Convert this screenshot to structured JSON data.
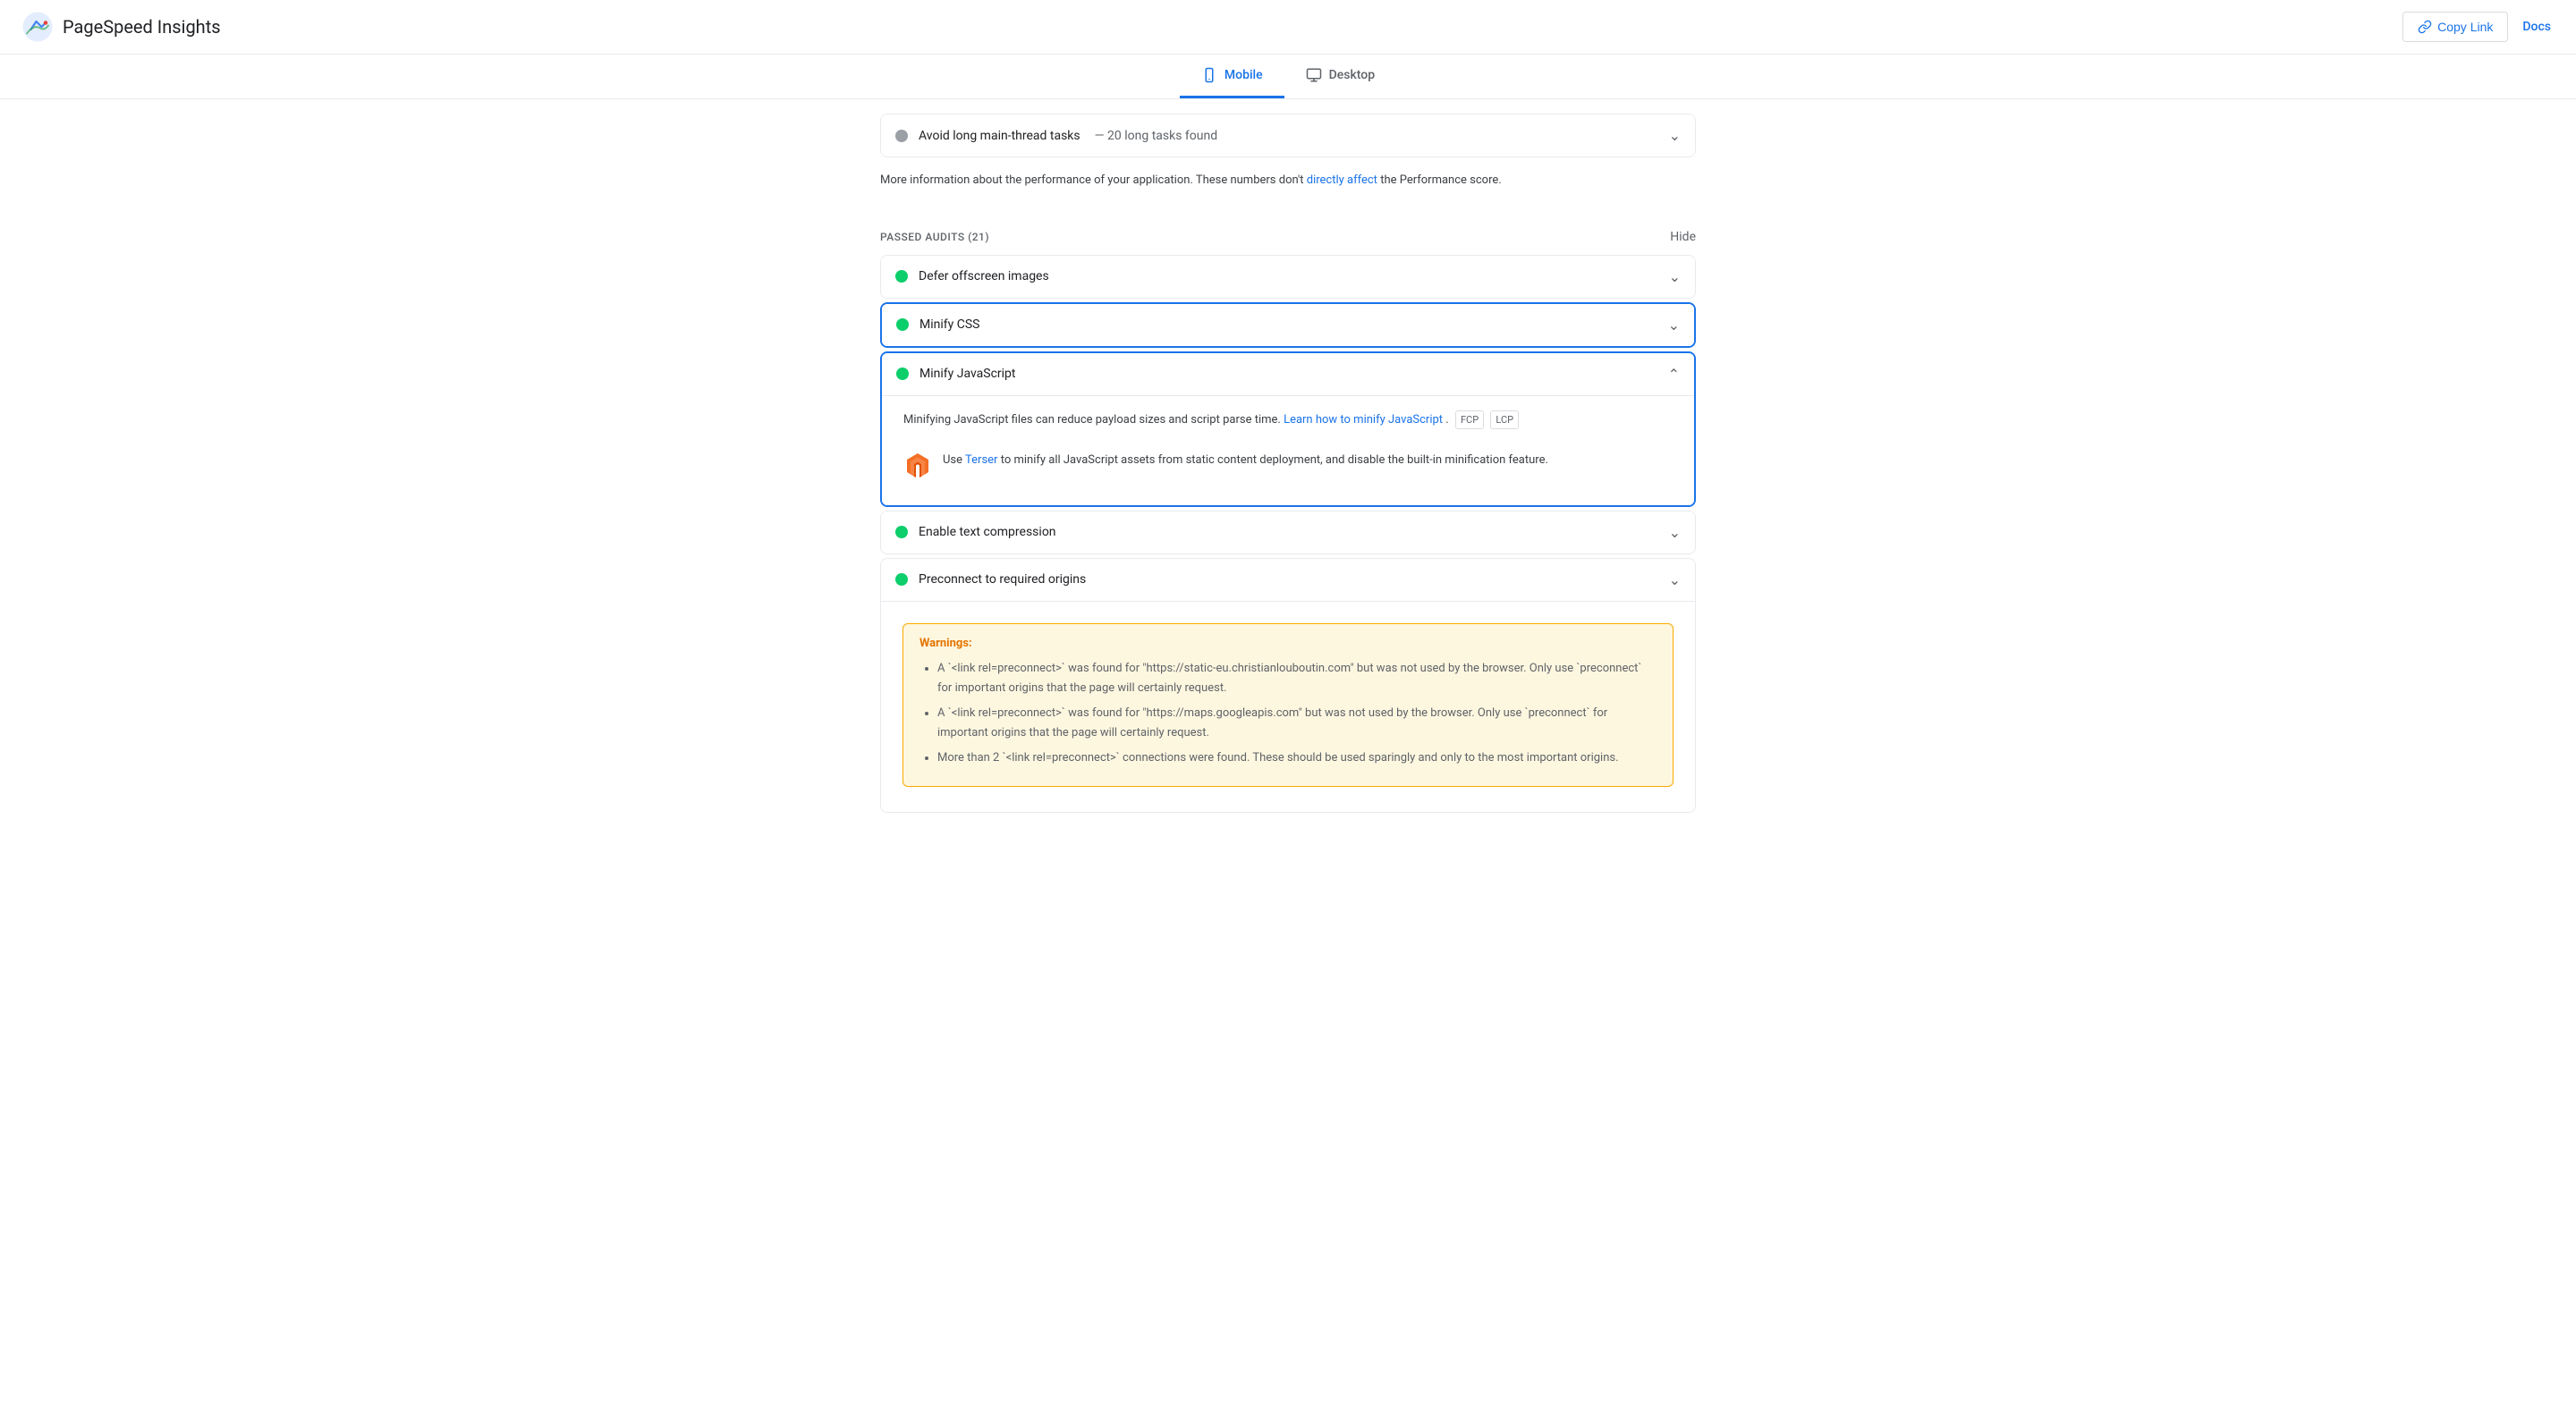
{
  "header": {
    "logo_text": "PageSpeed Insights",
    "copy_link_label": "Copy Link",
    "docs_label": "Docs"
  },
  "tabs": [
    {
      "id": "mobile",
      "label": "Mobile",
      "active": true
    },
    {
      "id": "desktop",
      "label": "Desktop",
      "active": false
    }
  ],
  "main_thread_audit": {
    "title": "Avoid long main-thread tasks",
    "subtitle": "— 20 long tasks found",
    "status": "grey",
    "expanded": false
  },
  "info_text": "More information about the performance of your application. These numbers don't",
  "info_link_text": "directly affect",
  "info_text_after": "the Performance score.",
  "passed_audits": {
    "section_title": "PASSED AUDITS (21)",
    "hide_label": "Hide"
  },
  "audits": [
    {
      "id": "defer-offscreen",
      "title": "Defer offscreen images",
      "status": "green",
      "expanded": false,
      "chevron": "down"
    },
    {
      "id": "minify-css",
      "title": "Minify CSS",
      "status": "green",
      "expanded": false,
      "chevron": "down"
    },
    {
      "id": "minify-js",
      "title": "Minify JavaScript",
      "status": "green",
      "expanded": true,
      "chevron": "up",
      "description_before": "Minifying JavaScript files can reduce payload sizes and script parse time.",
      "description_link_text": "Learn how to minify JavaScript",
      "description_after": ".",
      "tags": [
        "FCP",
        "LCP"
      ],
      "suggestion_link_text": "Terser",
      "suggestion_text_before": "Use",
      "suggestion_text_after": "to minify all JavaScript assets from static content deployment, and disable the built-in minification feature."
    },
    {
      "id": "text-compression",
      "title": "Enable text compression",
      "status": "green",
      "expanded": false,
      "chevron": "down"
    },
    {
      "id": "preconnect",
      "title": "Preconnect to required origins",
      "status": "green",
      "expanded": true,
      "chevron": "down",
      "warnings_title": "Warnings:",
      "warnings": [
        "A `<link rel=preconnect>` was found for \"https://static-eu.christianlouboutin.com\" but was not used by the browser. Only use `preconnect` for important origins that the page will certainly request.",
        "A `<link rel=preconnect>` was found for \"https://maps.googleapis.com\" but was not used by the browser. Only use `preconnect` for important origins that the page will certainly request.",
        "More than 2 `<link rel=preconnect>` connections were found. These should be used sparingly and only to the most important origins."
      ]
    }
  ],
  "colors": {
    "green": "#0cce6b",
    "grey": "#9aa0a6",
    "blue": "#1a73e8",
    "warning_bg": "#fef7e0",
    "warning_border": "#f9ab00",
    "warning_text": "#e37400"
  }
}
